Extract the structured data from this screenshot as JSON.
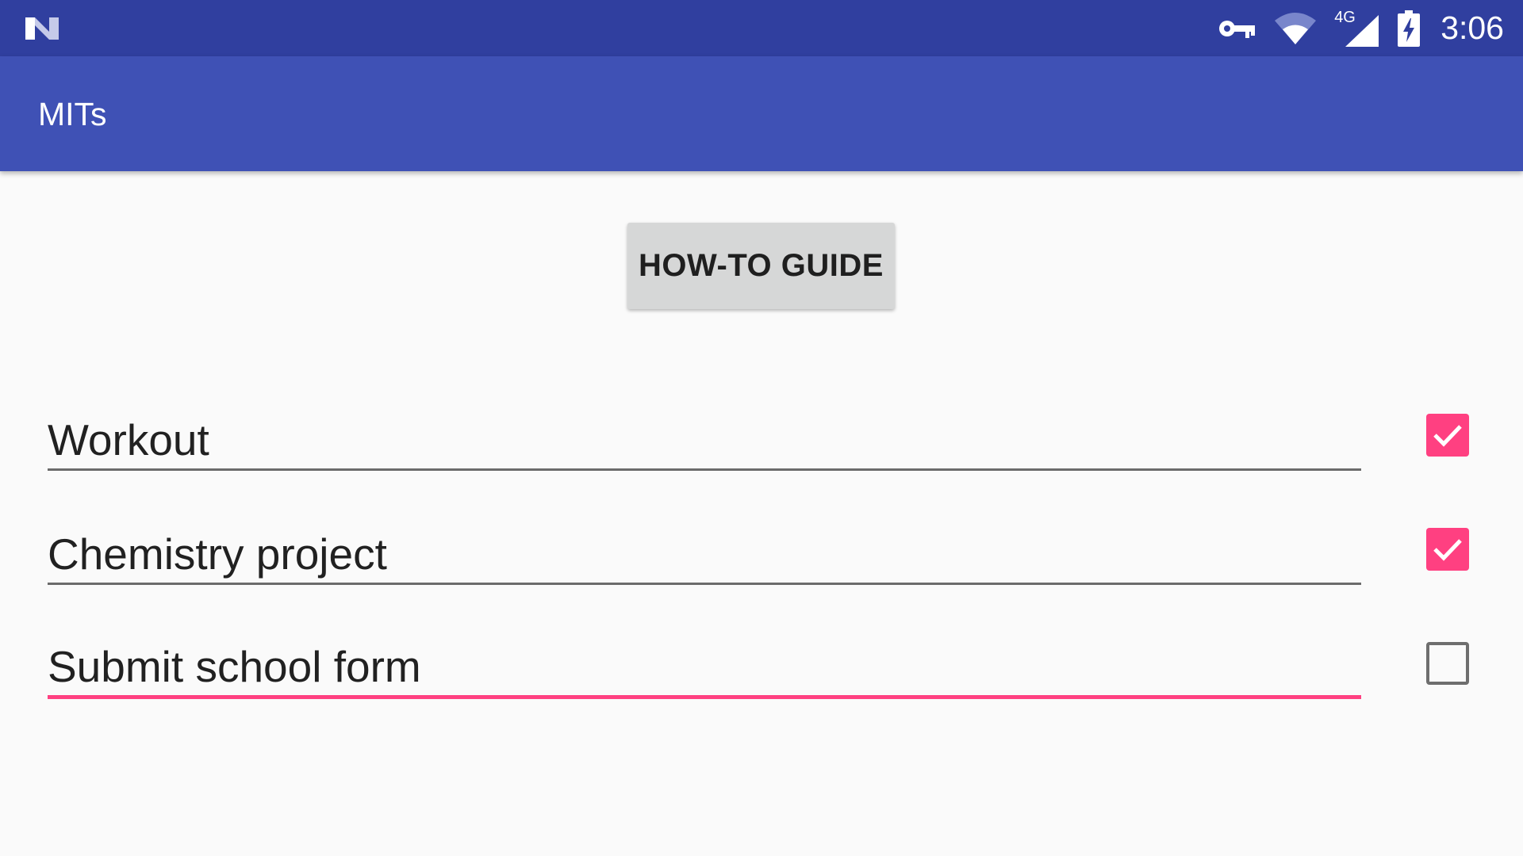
{
  "status_bar": {
    "logo_icon": "n-logo-icon",
    "icons": [
      "vpn-key-icon",
      "wifi-icon",
      "cellular-signal-icon",
      "battery-charging-icon"
    ],
    "network_type": "4G",
    "time": "3:06"
  },
  "app_bar": {
    "title": "MITs"
  },
  "main": {
    "guide_button_label": "HOW-TO GUIDE",
    "tasks": [
      {
        "text": "Workout",
        "checked": true
      },
      {
        "text": "Chemistry project",
        "checked": true
      },
      {
        "text": "Submit school form",
        "checked": false
      }
    ]
  },
  "colors": {
    "status_bar": "#303f9f",
    "app_bar": "#3f51b5",
    "accent": "#ff4081",
    "background": "#fafafa"
  }
}
